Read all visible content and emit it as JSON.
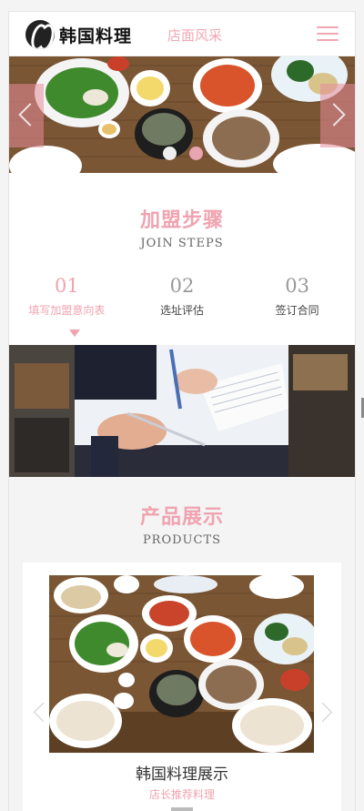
{
  "header": {
    "logo_text": "韩国料理",
    "nav_title": "店面风采",
    "menu_icon": "hamburger-menu-icon"
  },
  "colors": {
    "accent": "#f0a3b0",
    "dark": "#222222"
  },
  "banner": {
    "slides": 2,
    "active_slide": 2
  },
  "join_steps": {
    "title": "加盟步骤",
    "subtitle": "JOIN STEPS",
    "steps": [
      {
        "num": "01",
        "label": "填写加盟意向表"
      },
      {
        "num": "02",
        "label": "选址评估"
      },
      {
        "num": "03",
        "label": "签订合同"
      }
    ]
  },
  "products": {
    "title": "产品展示",
    "subtitle": "PRODUCTS",
    "item_name": "韩国料理展示",
    "item_sub": "店长推荐料理"
  }
}
